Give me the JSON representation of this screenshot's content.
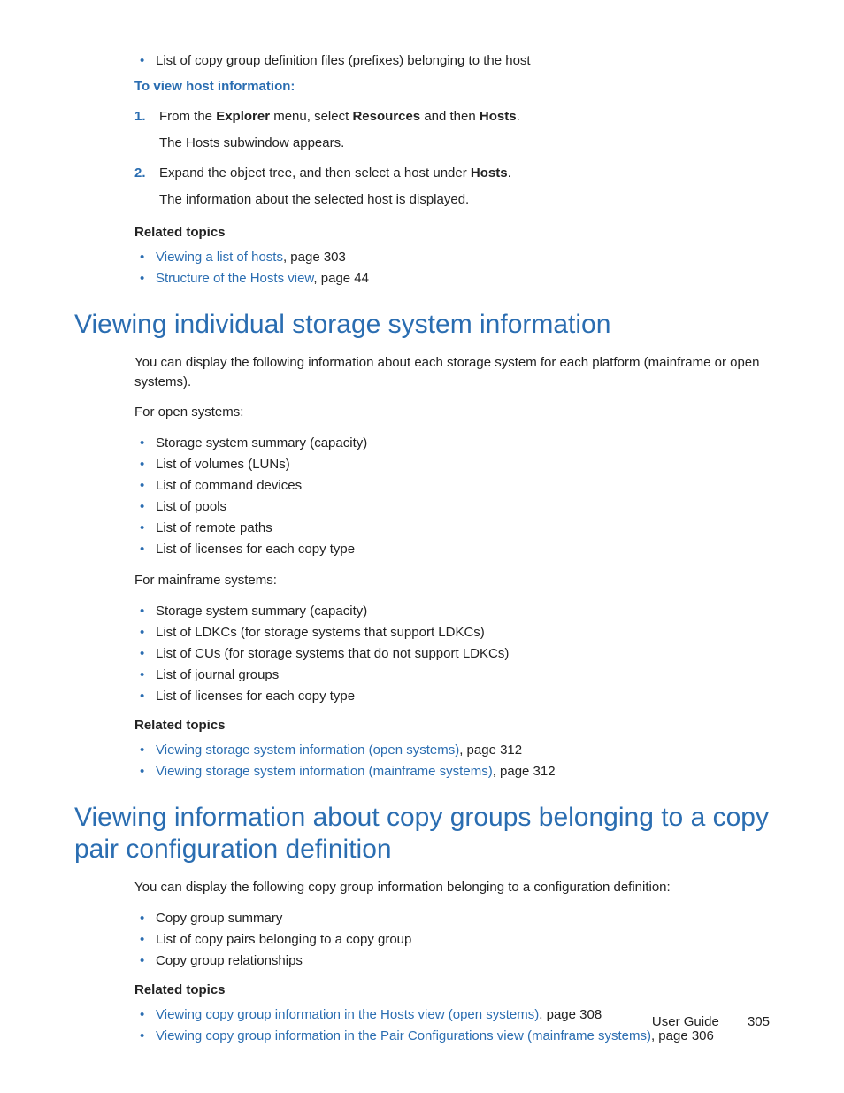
{
  "topBullet": "List of copy group definition files (prefixes) belonging to the host",
  "procedureTitle": "To view host information:",
  "steps": [
    {
      "num": "1.",
      "pre": "From the ",
      "b1": "Explorer",
      "mid1": " menu, select ",
      "b2": "Resources",
      "mid2": " and then ",
      "b3": "Hosts",
      "post": ".",
      "sub": "The Hosts subwindow appears."
    },
    {
      "num": "2.",
      "pre": "Expand the object tree, and then select a host under ",
      "b1": "Hosts",
      "post": ".",
      "sub": "The information about the selected host is displayed."
    }
  ],
  "relatedHeading": "Related topics",
  "related1": [
    {
      "link": "Viewing a list of hosts",
      "page": ", page 303"
    },
    {
      "link": "Structure of the Hosts view",
      "page": ", page 44"
    }
  ],
  "section2": {
    "title": "Viewing individual storage system information",
    "intro": "You can display the following information about each storage system for each platform (mainframe or open systems).",
    "openLabel": "For open systems:",
    "openItems": [
      "Storage system summary (capacity)",
      "List of volumes (LUNs)",
      "List of command devices",
      "List of pools",
      "List of remote paths",
      "List of licenses for each copy type"
    ],
    "mfLabel": "For mainframe systems:",
    "mfItems": [
      "Storage system summary (capacity)",
      "List of LDKCs (for storage systems that support LDKCs)",
      "List of CUs (for storage systems that do not support LDKCs)",
      "List of journal groups",
      "List of licenses for each copy type"
    ],
    "related": [
      {
        "link": "Viewing storage system information (open systems)",
        "page": ", page 312"
      },
      {
        "link": "Viewing storage system information (mainframe systems)",
        "page": ", page 312"
      }
    ]
  },
  "section3": {
    "title": "Viewing information about copy groups belonging to a copy pair configuration definition",
    "intro": "You can display the following copy group information belonging to a configuration definition:",
    "items": [
      "Copy group summary",
      "List of copy pairs belonging to a copy group",
      "Copy group relationships"
    ],
    "related": [
      {
        "link": "Viewing copy group information in the Hosts view (open systems)",
        "page": ", page 308"
      },
      {
        "link": "Viewing copy group information in the Pair Configurations view (mainframe systems)",
        "page": ", page 306"
      }
    ]
  },
  "footer": {
    "label": "User Guide",
    "page": "305"
  }
}
